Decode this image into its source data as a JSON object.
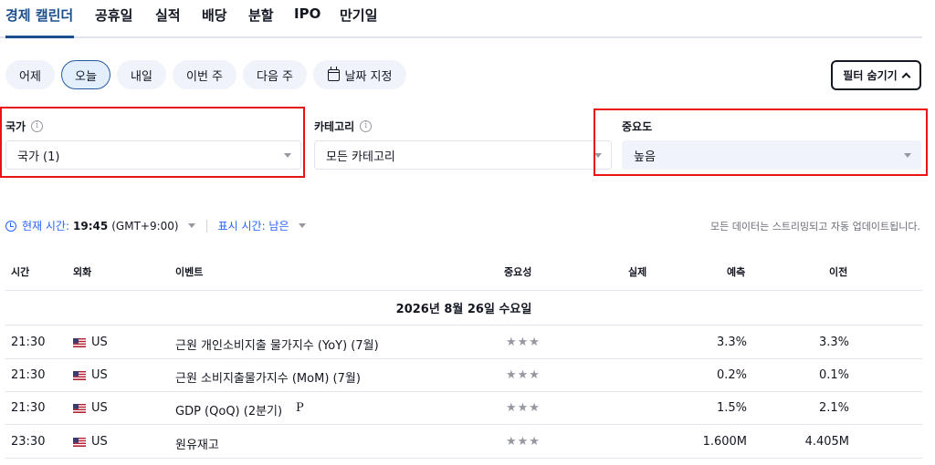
{
  "tabs": [
    "경제 캘린더",
    "공휴일",
    "실적",
    "배당",
    "분할",
    "IPO",
    "만기일"
  ],
  "date_buttons": [
    "어제",
    "오늘",
    "내일",
    "이번 주",
    "다음 주",
    "날짜 지정"
  ],
  "filter_toggle_label": "필터 숨기기",
  "filters": {
    "country": {
      "label": "국가",
      "value": "국가 (1)"
    },
    "category": {
      "label": "카테고리",
      "value": "모든 카테고리"
    },
    "importance": {
      "label": "중요도",
      "value": "높음"
    }
  },
  "time_bar": {
    "current_time_label": "현재 시간:",
    "current_time": "19:45",
    "timezone": "(GMT+9:00)",
    "display_time_label": "표시 시간: 남은",
    "stream_note": "모든 데이터는 스트리밍되고 자동 업데이트됩니다."
  },
  "table": {
    "headers": [
      "시간",
      "외화",
      "이벤트",
      "중요성",
      "실제",
      "예측",
      "이전"
    ],
    "date_label": "2026년 8월 26일 수요일",
    "rows": [
      {
        "time": "21:30",
        "currency": "US",
        "event": "근원 개인소비지출 물가지수 (YoY) (7월)",
        "stars": "★★★",
        "actual": "",
        "forecast": "3.3%",
        "previous": "3.3%"
      },
      {
        "time": "21:30",
        "currency": "US",
        "event": "근원 소비지출물가지수 (MoM) (7월)",
        "stars": "★★★",
        "actual": "",
        "forecast": "0.2%",
        "previous": "0.1%"
      },
      {
        "time": "21:30",
        "currency": "US",
        "event": "GDP (QoQ) (2분기)",
        "event_badge": "P",
        "stars": "★★★",
        "actual": "",
        "forecast": "1.5%",
        "previous": "2.1%"
      },
      {
        "time": "23:30",
        "currency": "US",
        "event": "원유재고",
        "stars": "★★★",
        "actual": "",
        "forecast": "1.600M",
        "previous": "4.405M"
      }
    ]
  },
  "colors": {
    "accent": "#1b4e8c",
    "highlight_box": "#e81414",
    "link_blue": "#2962ff"
  }
}
